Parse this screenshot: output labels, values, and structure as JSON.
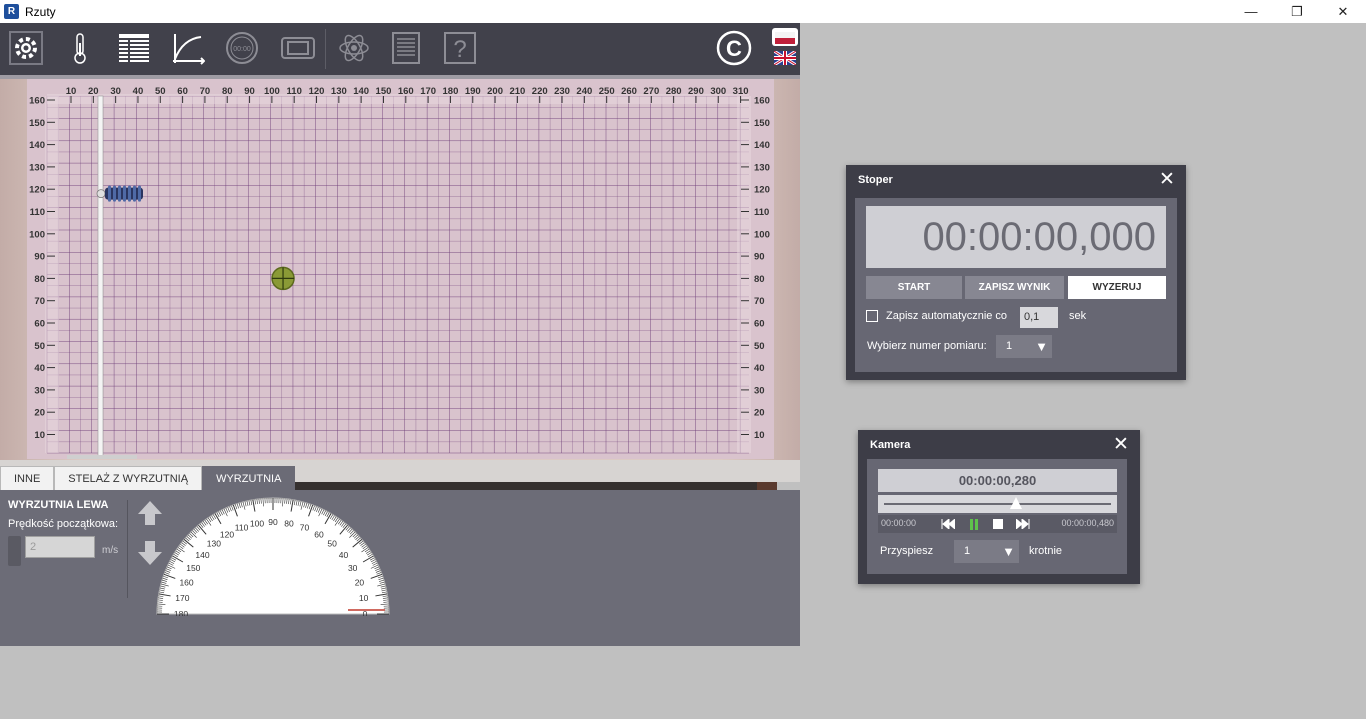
{
  "window": {
    "title": "Rzuty",
    "icon_letter": "R",
    "minimize": "—",
    "maximize": "❐",
    "close": "✕"
  },
  "toolbar": {
    "icons": [
      "gear-icon",
      "thermometer-icon",
      "table-icon",
      "graph-icon",
      "stopwatch-icon",
      "camera-icon",
      "atom-icon",
      "notes-icon",
      "help-icon",
      "copyright-icon",
      "flag-pl-icon",
      "flag-uk-icon"
    ],
    "help_glyph": "?",
    "copyright_glyph": "©",
    "stopwatch_text": "00:00"
  },
  "board": {
    "x_ticks": [
      "10",
      "20",
      "30",
      "40",
      "50",
      "60",
      "70",
      "80",
      "90",
      "100",
      "110",
      "120",
      "130",
      "140",
      "150",
      "160",
      "170",
      "180",
      "190",
      "200",
      "210",
      "220",
      "230",
      "240",
      "250",
      "260",
      "270",
      "280",
      "290",
      "300",
      "310"
    ],
    "y_ticks": [
      "160",
      "150",
      "140",
      "130",
      "120",
      "110",
      "100",
      "90",
      "80",
      "70",
      "60",
      "50",
      "40",
      "30",
      "20",
      "10"
    ],
    "launcher_height": 118,
    "target": {
      "x": 105,
      "y": 80
    }
  },
  "tabs": [
    {
      "label": "INNE",
      "active": false
    },
    {
      "label": "STELAŻ Z WYRZUTNIĄ",
      "active": false
    },
    {
      "label": "WYRZUTNIA",
      "active": true
    }
  ],
  "launcher_panel": {
    "title": "WYRZUTNIA LEWA",
    "speed_label": "Prędkość początkowa:",
    "speed_value": "2",
    "unit": "m/s",
    "protractor_labels": [
      "180",
      "170",
      "160",
      "150",
      "140",
      "130",
      "120",
      "110",
      "100",
      "90",
      "80",
      "70",
      "60",
      "50",
      "40",
      "30",
      "20",
      "10",
      "0"
    ]
  },
  "stoper": {
    "title": "Stoper",
    "time": "00:00:00,000",
    "buttons": {
      "start": "START",
      "save": "ZAPISZ WYNIK",
      "reset": "WYZERUJ"
    },
    "auto_label": "Zapisz automatycznie co",
    "auto_checked": false,
    "interval": "0,1",
    "interval_unit": "sek",
    "measurement_label": "Wybierz numer pomiaru:",
    "measurement_value": "1",
    "close": "✕"
  },
  "kamera": {
    "title": "Kamera",
    "time": "00:00:00,280",
    "start_time": "00:00:00",
    "end_time": "00:00:00,480",
    "progress": 0.583,
    "speed_label": "Przyspiesz",
    "speed_value": "1",
    "times_label": "krotnie",
    "close": "✕"
  },
  "colors": {
    "grid_line": "#6e3e78",
    "board_bg": "#d9c3cd",
    "toolbar_bg": "#41414b",
    "panel_bg": "#6c6c77",
    "pause_green": "#5fc24c"
  }
}
